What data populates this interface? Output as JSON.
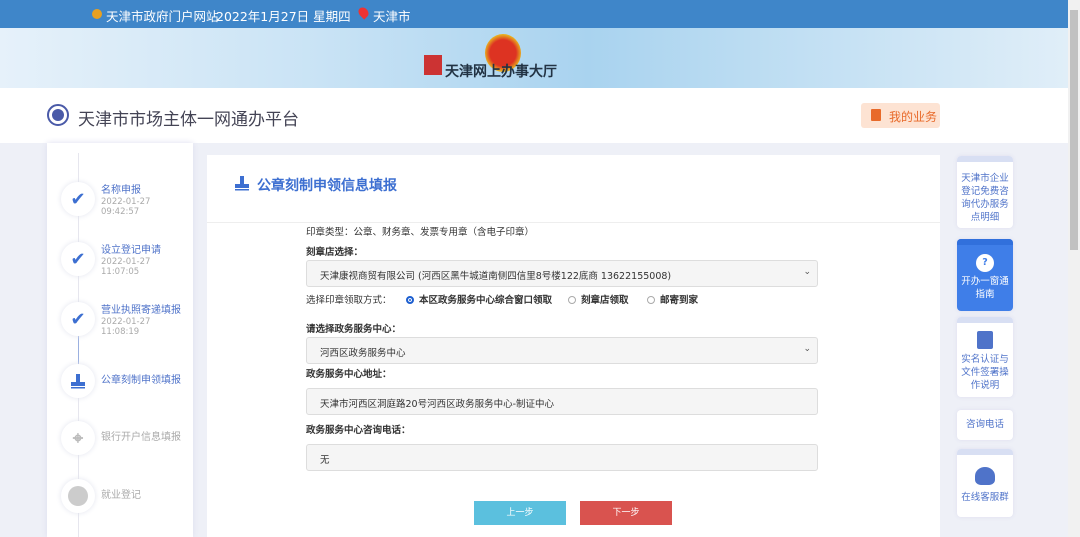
{
  "topbar": {
    "portal": "天津市政府门户网站",
    "date": "2022年1月27日 星期四",
    "city": "天津市"
  },
  "banner": {
    "hall": "天津网上办事大厅"
  },
  "header": {
    "title": "天津市市场主体一网通办平台",
    "my_business": "我的业务"
  },
  "steps": [
    {
      "label": "名称申报",
      "date": "2022-01-27",
      "time": "09:42:57",
      "status": "done"
    },
    {
      "label": "设立登记申请",
      "date": "2022-01-27",
      "time": "11:07:05",
      "status": "done"
    },
    {
      "label": "营业执照寄递填报",
      "date": "2022-01-27",
      "time": "11:08:19",
      "status": "done"
    },
    {
      "label": "公章刻制申领填报",
      "status": "current"
    },
    {
      "label": "银行开户信息填报",
      "status": "pending"
    },
    {
      "label": "就业登记",
      "status": "pending"
    }
  ],
  "form": {
    "title": "公章刻制申领信息填报",
    "seal_types": "印章类型：公章、财务章、发票专用章（含电子印章）",
    "shop_label": "刻章店选择：",
    "shop_value": "天津康视商贸有限公司 (河西区黑牛城道南侧四信里8号楼122底商 13622155008)",
    "pickup_label": "选择印章领取方式：",
    "pickup_options": [
      "本区政务服务中心综合窗口领取",
      "刻章店领取",
      "邮寄到家"
    ],
    "pickup_selected": 0,
    "center_label": "请选择政务服务中心：",
    "center_value": "河西区政务服务中心",
    "address_label": "政务服务中心地址：",
    "address_value": "天津市河西区洞庭路20号河西区政务服务中心-制证中心",
    "phone_label": "政务服务中心咨询电话：",
    "phone_value": "无",
    "prev": "上一步",
    "next": "下一步"
  },
  "right": {
    "free_service": "天津市企业登记免费咨询代办服务点明细",
    "guide": "开办一窗通指南",
    "realname": "实名认证与文件签署操作说明",
    "hotline": "咨询电话",
    "group": "在线客服群"
  },
  "colors": {
    "accent": "#3d6fd1",
    "topbar": "#3f86c9",
    "prev": "#5bc0de",
    "next": "#d9534f"
  }
}
